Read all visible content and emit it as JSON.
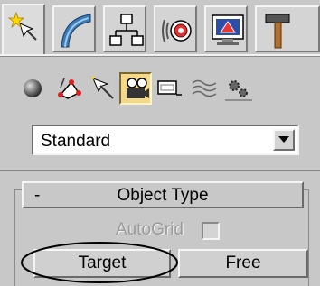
{
  "command_tabs": [
    {
      "icon": "create-icon",
      "active": true
    },
    {
      "icon": "modify-icon",
      "active": false
    },
    {
      "icon": "hierarchy-icon",
      "active": false
    },
    {
      "icon": "motion-icon",
      "active": false
    },
    {
      "icon": "display-icon",
      "active": false
    },
    {
      "icon": "utilities-icon",
      "active": false
    }
  ],
  "categories": [
    {
      "icon": "geometry-icon",
      "active": false
    },
    {
      "icon": "shapes-icon",
      "active": false
    },
    {
      "icon": "lights-icon",
      "active": false
    },
    {
      "icon": "cameras-icon",
      "active": true
    },
    {
      "icon": "helpers-icon",
      "active": false
    },
    {
      "icon": "space-warps-icon",
      "active": false
    },
    {
      "icon": "systems-icon",
      "active": false
    }
  ],
  "dropdown": {
    "value": "Standard"
  },
  "rollout": {
    "toggle": "-",
    "title": "Object Type",
    "autogrid_label": "AutoGrid",
    "autogrid_checked": false,
    "buttons": [
      "Target",
      "Free"
    ]
  },
  "colors": {
    "panel_bg": "#c8c8c8",
    "active_category_bg": "#f4d98a",
    "disabled_text": "#9a9a9a"
  }
}
